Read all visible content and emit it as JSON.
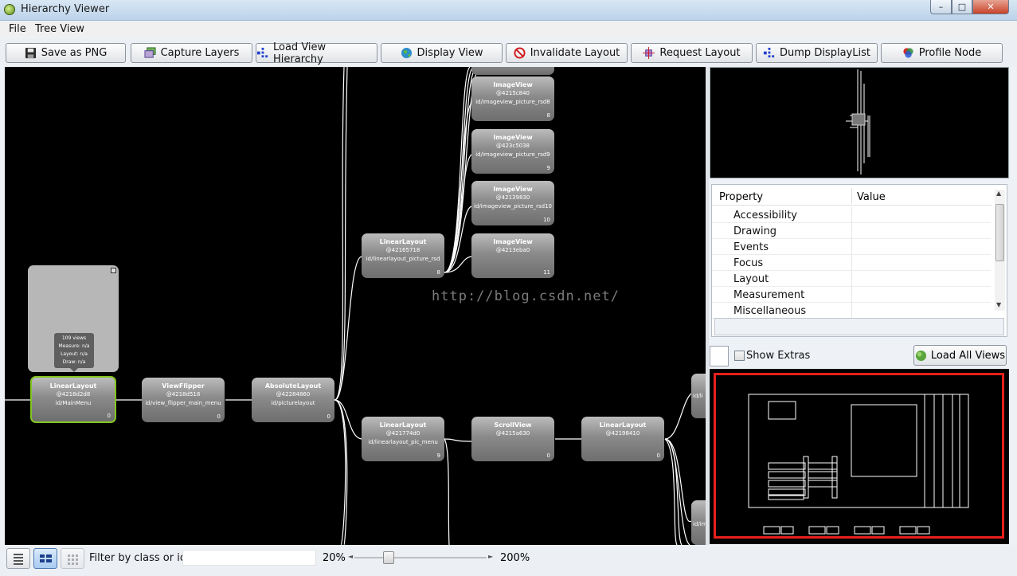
{
  "window": {
    "title": "Hierarchy Viewer",
    "min": "–",
    "max": "□",
    "close": "✕"
  },
  "menu": {
    "file": "File",
    "tree_view": "Tree View"
  },
  "toolbar": {
    "save_png": "Save as PNG",
    "capture_layers": "Capture Layers",
    "load_view_hierarchy": "Load View Hierarchy",
    "display_view": "Display View",
    "invalidate_layout": "Invalidate Layout",
    "request_layout": "Request Layout",
    "dump_displaylist": "Dump DisplayList",
    "profile_node": "Profile Node"
  },
  "tooltip": {
    "views": "109 views",
    "measure": "Measure: n/a",
    "layout": "Layout: n/a",
    "draw": "Draw: n/a"
  },
  "watermark": "http://blog.csdn.net/",
  "nodes": {
    "linear_main": {
      "name": "LinearLayout",
      "addr": "@4218d2d8",
      "id": "id/MainMenu",
      "idx": "0"
    },
    "viewflipper": {
      "name": "ViewFlipper",
      "addr": "@4218d518",
      "id": "id/view_flipper_main_menu",
      "idx": "0"
    },
    "absolute": {
      "name": "AbsoluteLayout",
      "addr": "@42284860",
      "id": "id/picturelayout",
      "idx": "0"
    },
    "linear_picture": {
      "name": "LinearLayout",
      "addr": "@42165718",
      "id": "id/linearlayout_picture_rsd",
      "idx": "8"
    },
    "linear_pic_menu": {
      "name": "LinearLayout",
      "addr": "@421774d0",
      "id": "id/linearlayout_pic_menu",
      "idx": "9"
    },
    "scrollview": {
      "name": "ScrollView",
      "addr": "@4215a630",
      "id": "",
      "idx": "0"
    },
    "linear_scroll": {
      "name": "LinearLayout",
      "addr": "@42198410",
      "id": "",
      "idx": "0"
    },
    "img8": {
      "name": "ImageView",
      "addr": "@4215c840",
      "id": "id/imageview_picture_rsd8",
      "idx": "8"
    },
    "img9": {
      "name": "ImageView",
      "addr": "@423c5038",
      "id": "id/imageview_picture_rsd9",
      "idx": "9"
    },
    "img10": {
      "name": "ImageView",
      "addr": "@42139830",
      "id": "id/imageview_picture_rsd10",
      "idx": "10"
    },
    "img11": {
      "name": "ImageView",
      "addr": "@4213eba0",
      "id": "",
      "idx": "11"
    },
    "partial_a": {
      "id": "id/li"
    },
    "partial_b": {
      "id": "id/ime"
    }
  },
  "properties": {
    "header_property": "Property",
    "header_value": "Value",
    "rows": [
      "Accessibility",
      "Drawing",
      "Events",
      "Focus",
      "Layout",
      "Measurement",
      "Miscellaneous"
    ]
  },
  "extras": {
    "show_extras": "Show Extras",
    "load_all_views": "Load All Views"
  },
  "statusbar": {
    "filter_label": "Filter by class or id:",
    "zoom_min": "20%",
    "zoom_max": "200%",
    "zoom_level": 0.16
  },
  "colors": {
    "selected_border": "#83c521",
    "layout_frame": "#e8201b",
    "canvas": "#000000"
  },
  "icons": {
    "save": "floppy-disk-icon",
    "capture": "layers-icon",
    "load": "hierarchy-icon",
    "display": "globe-icon",
    "invalidate": "no-entry-icon",
    "request": "crosshair-icon",
    "dump": "hierarchy-icon",
    "profile": "venn-circles-icon",
    "load_all": "globe-icon"
  }
}
